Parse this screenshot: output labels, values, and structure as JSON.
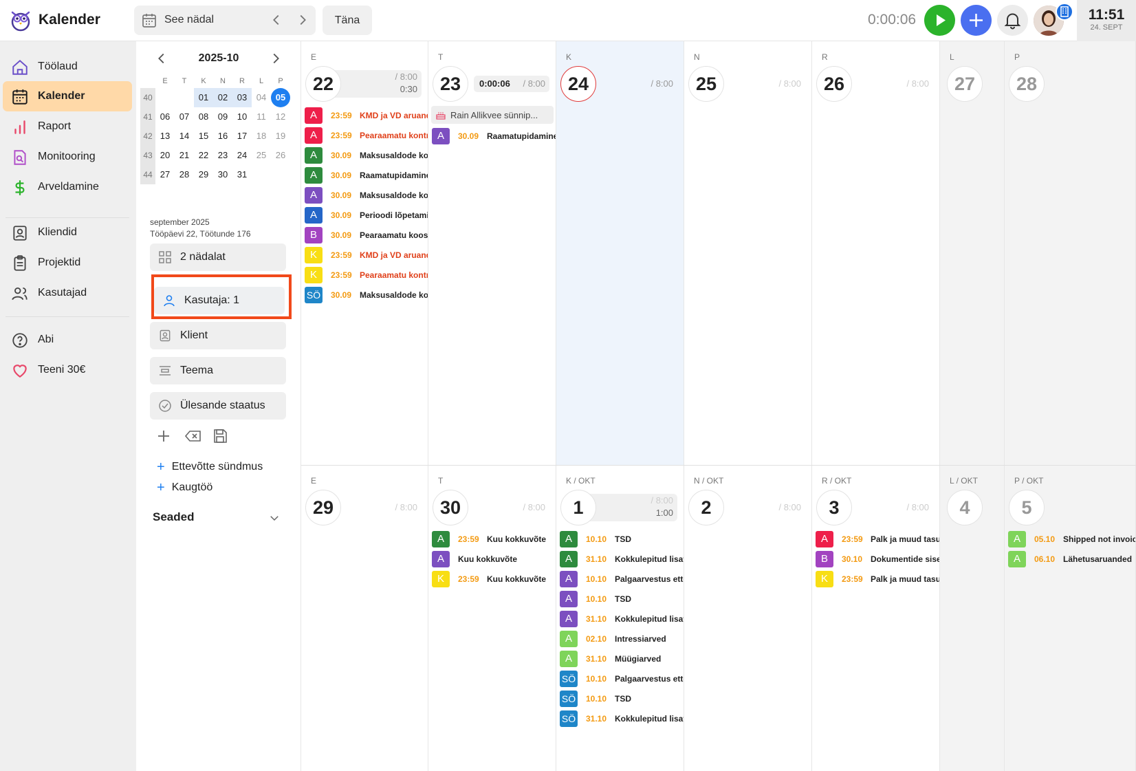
{
  "app": {
    "title": "Kalender"
  },
  "topbar": {
    "week_label": "See nädal",
    "today_label": "Täna",
    "timer": "0:00:06",
    "clock_time": "11:51",
    "clock_date": "24. SEPT"
  },
  "nav": {
    "main": [
      {
        "key": "toolaud",
        "label": "Töölaud",
        "icon": "home-icon"
      },
      {
        "key": "kalender",
        "label": "Kalender",
        "icon": "calendar-icon",
        "active": true
      },
      {
        "key": "raport",
        "label": "Raport",
        "icon": "bar-chart-icon"
      },
      {
        "key": "monitooring",
        "label": "Monitooring",
        "icon": "document-search-icon"
      },
      {
        "key": "arveldamine",
        "label": "Arveldamine",
        "icon": "dollar-icon"
      }
    ],
    "secondary": [
      {
        "key": "kliendid",
        "label": "Kliendid",
        "icon": "contact-card-icon"
      },
      {
        "key": "projektid",
        "label": "Projektid",
        "icon": "clipboard-icon"
      },
      {
        "key": "kasutajad",
        "label": "Kasutajad",
        "icon": "users-icon"
      }
    ],
    "tertiary": [
      {
        "key": "abi",
        "label": "Abi",
        "icon": "help-icon"
      },
      {
        "key": "teeni",
        "label": "Teeni 30€",
        "icon": "heart-icon"
      }
    ]
  },
  "minical": {
    "title": "2025-10",
    "dow": [
      "E",
      "T",
      "K",
      "N",
      "R",
      "L",
      "P"
    ],
    "weeks": [
      {
        "wk": "40",
        "days": [
          "",
          "",
          "01",
          "02",
          "03",
          "04",
          "05"
        ]
      },
      {
        "wk": "41",
        "days": [
          "06",
          "07",
          "08",
          "09",
          "10",
          "11",
          "12"
        ]
      },
      {
        "wk": "42",
        "days": [
          "13",
          "14",
          "15",
          "16",
          "17",
          "18",
          "19"
        ]
      },
      {
        "wk": "43",
        "days": [
          "20",
          "21",
          "22",
          "23",
          "24",
          "25",
          "26"
        ]
      },
      {
        "wk": "44",
        "days": [
          "27",
          "28",
          "29",
          "30",
          "31",
          "",
          ""
        ]
      }
    ]
  },
  "month_info": {
    "line1": "september 2025",
    "line2": "Tööpäevi 22, Töötunde 176"
  },
  "filters": {
    "weeks": "2 nädalat",
    "user": "Kasutaja: 1",
    "client": "Klient",
    "theme": "Teema",
    "task_status": "Ülesande staatus"
  },
  "add_links": {
    "company_event": "Ettevõtte sündmus",
    "remote": "Kaugtöö"
  },
  "settings_label": "Seaded",
  "colors": {
    "red": "#ee1f4a",
    "orange": "#f46a1e",
    "dkgreen": "#2e8b3e",
    "purple": "#7c4fc0",
    "blue": "#2566c8",
    "magenta": "#a243c0",
    "yellow": "#f8de14",
    "teal": "#1f86c8",
    "lime": "#7fd45a",
    "accent": "#1e7ff0",
    "highlight": "#f1491a"
  },
  "weeks": [
    {
      "days": [
        {
          "dow": "E",
          "num": "22",
          "hours": "/ 8:00",
          "sub": "0:30",
          "events": [
            {
              "b": "A",
              "c": "red",
              "d": "23:59",
              "t": "KMD ja VD aruande",
              "dc": "#f39a12",
              "tc": "#e0401a"
            },
            {
              "b": "A",
              "c": "red",
              "d": "23:59",
              "t": "Pearaamatu kontroll",
              "dc": "#f39a12",
              "tc": "#e0401a"
            },
            {
              "b": "A",
              "c": "dkgreen",
              "d": "30.09",
              "t": "Maksusaldode kontroll",
              "dc": "#f39a12"
            },
            {
              "b": "A",
              "c": "dkgreen",
              "d": "30.09",
              "t": "Raamatupidamine",
              "dc": "#f39a12"
            },
            {
              "b": "A",
              "c": "purple",
              "d": "30.09",
              "t": "Maksusaldode kontroll",
              "dc": "#f39a12"
            },
            {
              "b": "A",
              "c": "blue",
              "d": "30.09",
              "t": "Perioodi lõpetamine",
              "dc": "#f39a12"
            },
            {
              "b": "B",
              "c": "magenta",
              "d": "30.09",
              "t": "Pearaamatu koostamine",
              "dc": "#f39a12"
            },
            {
              "b": "K",
              "c": "yellow",
              "d": "23:59",
              "t": "KMD ja VD aruande",
              "dc": "#f39a12",
              "tc": "#e0401a"
            },
            {
              "b": "K",
              "c": "yellow",
              "d": "23:59",
              "t": "Pearaamatu kontroll",
              "dc": "#f39a12",
              "tc": "#e0401a"
            },
            {
              "b": "SÖ",
              "c": "teal",
              "d": "30.09",
              "t": "Maksusaldode kontroll",
              "dc": "#f39a12"
            }
          ]
        },
        {
          "dow": "T",
          "num": "23",
          "timer": "0:00:06",
          "hours": "/ 8:00",
          "birthday": "Rain Allikvee sünnip...",
          "events": [
            {
              "b": "A",
              "c": "purple",
              "d": "30.09",
              "t": "Raamatupidamine",
              "dc": "#f39a12"
            }
          ]
        },
        {
          "dow": "K",
          "num": "24",
          "hours": "/ 8:00",
          "today": true,
          "events": []
        },
        {
          "dow": "N",
          "num": "25",
          "hours": "/ 8:00",
          "light": true,
          "events": []
        },
        {
          "dow": "R",
          "num": "26",
          "hours": "/ 8:00",
          "light": true,
          "events": []
        },
        {
          "dow": "L",
          "num": "27",
          "we": true,
          "events": []
        },
        {
          "dow": "P",
          "num": "28",
          "we": true,
          "events": []
        }
      ]
    },
    {
      "days": [
        {
          "dow": "E",
          "num": "29",
          "hours": "/ 8:00",
          "light": true,
          "events": []
        },
        {
          "dow": "T",
          "num": "30",
          "hours": "/ 8:00",
          "light": true,
          "events": [
            {
              "b": "A",
              "c": "dkgreen",
              "d": "23:59",
              "t": "Kuu kokkuvõte",
              "dc": "#f39a12"
            },
            {
              "b": "A",
              "c": "purple",
              "d": "",
              "t": "Kuu kokkuvõte",
              "dc": "#f39a12"
            },
            {
              "b": "K",
              "c": "yellow",
              "d": "23:59",
              "t": "Kuu kokkuvõte",
              "dc": "#f39a12"
            }
          ]
        },
        {
          "dow": "K / OKT",
          "num": "1",
          "hours": "/ 8:00",
          "sub": "1:00",
          "light": true,
          "events": [
            {
              "b": "A",
              "c": "dkgreen",
              "d": "10.10",
              "t": "TSD",
              "dc": "#f39a12"
            },
            {
              "b": "A",
              "c": "dkgreen",
              "d": "31.10",
              "t": "Kokkulepitud lisatööd",
              "dc": "#f39a12"
            },
            {
              "b": "A",
              "c": "purple",
              "d": "10.10",
              "t": "Palgaarvestus ettevõttele",
              "dc": "#f39a12"
            },
            {
              "b": "A",
              "c": "purple",
              "d": "10.10",
              "t": "TSD",
              "dc": "#f39a12"
            },
            {
              "b": "A",
              "c": "purple",
              "d": "31.10",
              "t": "Kokkulepitud lisatööd",
              "dc": "#f39a12"
            },
            {
              "b": "A",
              "c": "lime",
              "d": "02.10",
              "t": "Intressiarved",
              "dc": "#f39a12"
            },
            {
              "b": "A",
              "c": "lime",
              "d": "31.10",
              "t": "Müügiarved",
              "dc": "#f39a12"
            },
            {
              "b": "SÖ",
              "c": "teal",
              "d": "10.10",
              "t": "Palgaarvestus ettevõttele",
              "dc": "#f39a12"
            },
            {
              "b": "SÖ",
              "c": "teal",
              "d": "10.10",
              "t": "TSD",
              "dc": "#f39a12"
            },
            {
              "b": "SÖ",
              "c": "teal",
              "d": "31.10",
              "t": "Kokkulepitud lisatööd",
              "dc": "#f39a12"
            }
          ]
        },
        {
          "dow": "N / OKT",
          "num": "2",
          "hours": "/ 8:00",
          "light": true,
          "events": []
        },
        {
          "dow": "R / OKT",
          "num": "3",
          "hours": "/ 8:00",
          "light": true,
          "events": [
            {
              "b": "A",
              "c": "red",
              "d": "23:59",
              "t": "Palk ja muud tasud",
              "dc": "#f39a12"
            },
            {
              "b": "B",
              "c": "magenta",
              "d": "30.10",
              "t": "Dokumentide sisestus",
              "dc": "#f39a12"
            },
            {
              "b": "K",
              "c": "yellow",
              "d": "23:59",
              "t": "Palk ja muud tasud",
              "dc": "#f39a12"
            }
          ]
        },
        {
          "dow": "L / OKT",
          "num": "4",
          "we": true,
          "events": []
        },
        {
          "dow": "P / OKT",
          "num": "5",
          "we": true,
          "events": [
            {
              "b": "A",
              "c": "lime",
              "d": "05.10",
              "t": "Shipped not invoiced",
              "dc": "#f39a12"
            },
            {
              "b": "A",
              "c": "lime",
              "d": "06.10",
              "t": "Lähetusaruanded",
              "dc": "#f39a12"
            }
          ]
        }
      ]
    }
  ]
}
